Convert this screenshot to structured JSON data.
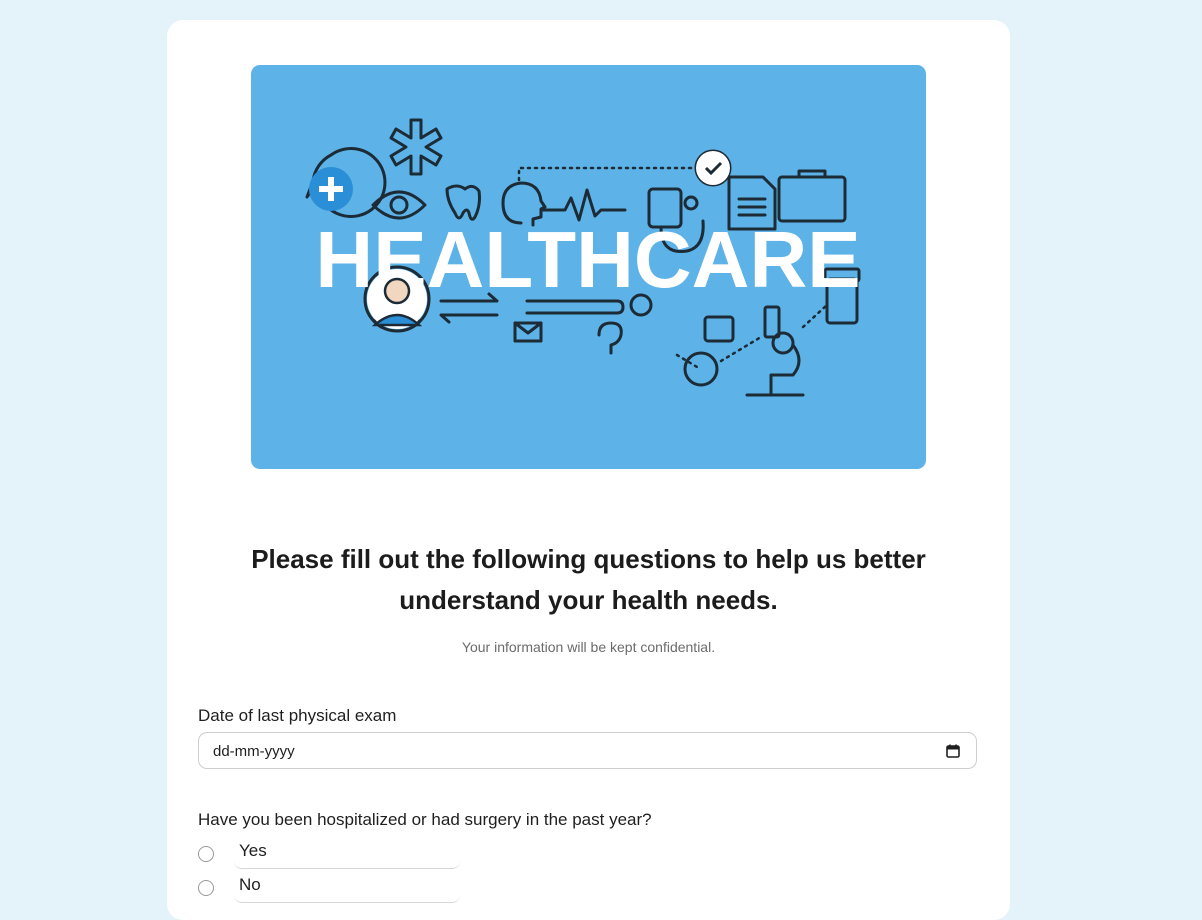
{
  "hero": {
    "banner_text": "HEALTHCARE"
  },
  "form": {
    "heading": "Please fill out the following questions to help us better understand your health needs.",
    "subtext": "Your information will be kept confidential.",
    "exam_date": {
      "label": "Date of last physical exam",
      "placeholder": "dd-mm-yyyy"
    },
    "hospitalized": {
      "question": "Have you been hospitalized or had surgery in the past year?",
      "options": [
        "Yes",
        "No"
      ]
    }
  },
  "colors": {
    "page_background": "#e4f2fa",
    "hero_background": "#5db3e8",
    "icon_stroke": "#1d2b36"
  }
}
